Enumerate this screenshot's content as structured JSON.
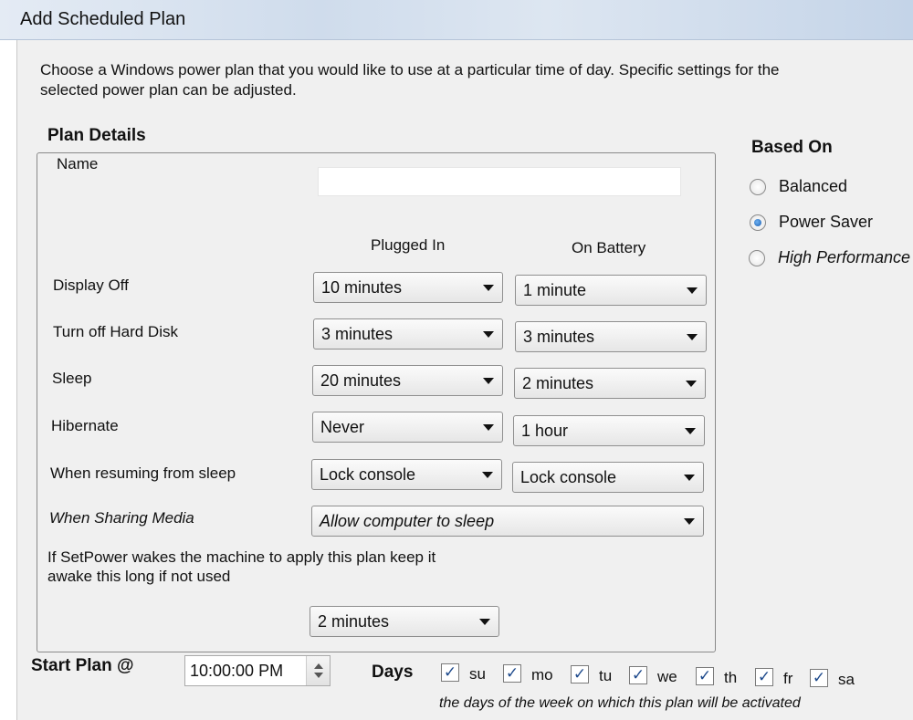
{
  "window": {
    "title": "Add Scheduled Plan"
  },
  "intro": "Choose a Windows power plan that you would like to use at a particular time of day.  Specific settings for the selected power plan can be adjusted.",
  "plan_details": {
    "heading": "Plan Details",
    "name_label": "Name",
    "name_value": "",
    "col_plugged": "Plugged In",
    "col_battery": "On Battery",
    "rows": [
      {
        "label": "Display Off",
        "plugged": "10 minutes",
        "battery": "1 minute"
      },
      {
        "label": "Turn off Hard Disk",
        "plugged": "3 minutes",
        "battery": "3 minutes"
      },
      {
        "label": "Sleep",
        "plugged": "20 minutes",
        "battery": "2 minutes"
      },
      {
        "label": "Hibernate",
        "plugged": "Never",
        "battery": "1 hour"
      },
      {
        "label": "When resuming from sleep",
        "plugged": "Lock console",
        "battery": "Lock console"
      }
    ],
    "sharing_label": "When Sharing Media",
    "sharing_value": "Allow computer to sleep",
    "wake_text": "If SetPower wakes the machine to apply this plan keep it awake this long if not used",
    "wake_value": "2 minutes"
  },
  "based_on": {
    "heading": "Based On",
    "options": [
      "Balanced",
      "Power Saver",
      "High Performance"
    ],
    "selected": "Power Saver"
  },
  "start": {
    "label": "Start Plan @",
    "time": "10:00:00 PM"
  },
  "days": {
    "label": "Days",
    "items": [
      {
        "label": "su",
        "checked": true
      },
      {
        "label": "mo",
        "checked": true
      },
      {
        "label": "tu",
        "checked": true
      },
      {
        "label": "we",
        "checked": true
      },
      {
        "label": "th",
        "checked": true
      },
      {
        "label": "fr",
        "checked": true
      },
      {
        "label": "sa",
        "checked": true
      }
    ],
    "hint": "the days of the week on which this plan will be activated"
  }
}
